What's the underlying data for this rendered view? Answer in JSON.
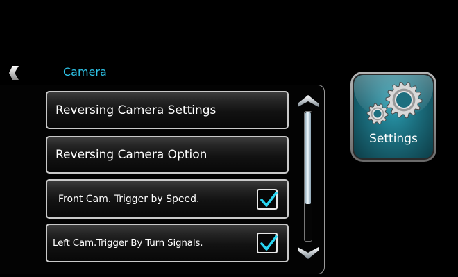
{
  "header": {
    "title": "Camera",
    "back_icon": "chevron-left-icon"
  },
  "menu": {
    "items": [
      {
        "label": "Reversing Camera Settings",
        "type": "button"
      },
      {
        "label": "Reversing Camera Option",
        "type": "button"
      },
      {
        "label": "Front Cam. Trigger by Speed.",
        "type": "checkbox",
        "checked": true
      },
      {
        "label": "Left Cam.Trigger By Turn Signals.",
        "type": "checkbox",
        "checked": true
      }
    ]
  },
  "scrollbar": {
    "up_icon": "chevron-up-icon",
    "down_icon": "chevron-down-icon",
    "position": 0
  },
  "settings_button": {
    "label": "Settings",
    "icon": "gears-icon"
  },
  "colors": {
    "accent": "#2ec4e8",
    "check": "#29d6f2",
    "settings_bg": "#1b6e7e"
  }
}
